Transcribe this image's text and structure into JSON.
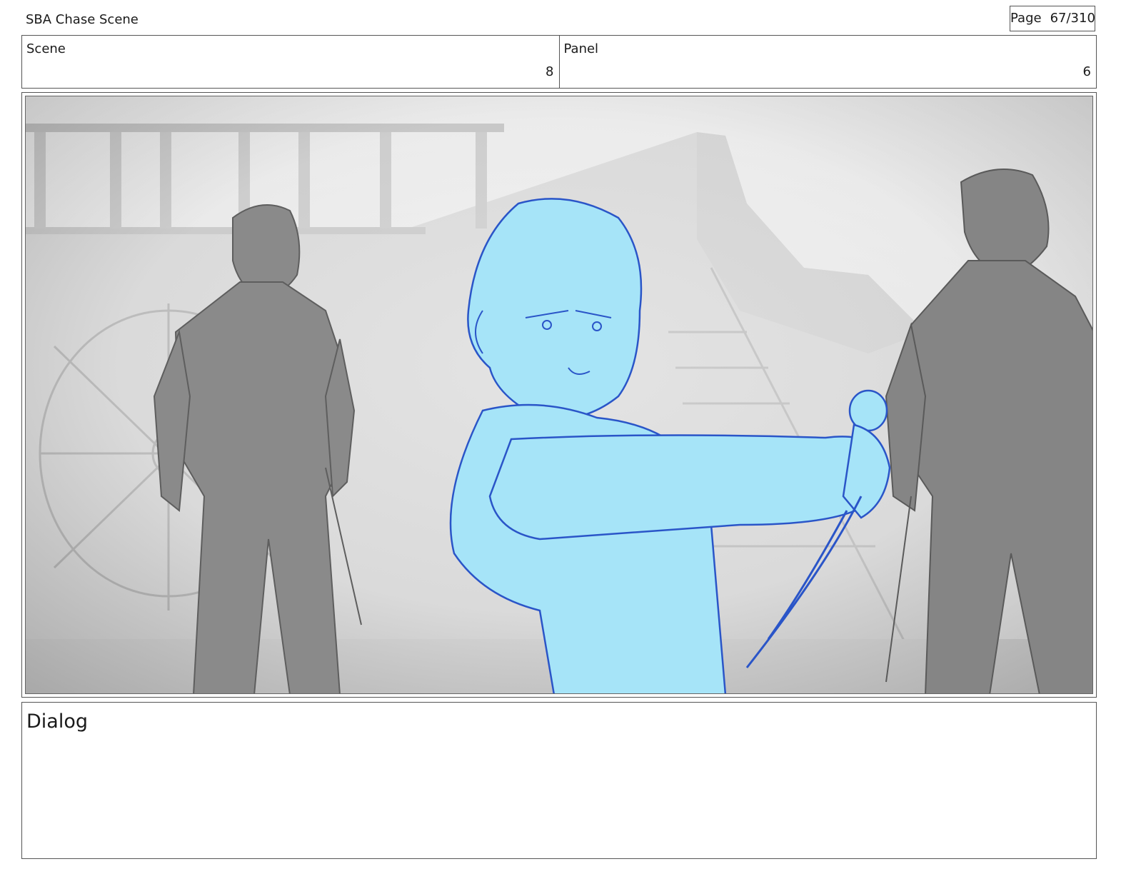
{
  "header": {
    "title": "SBA Chase Scene",
    "page_label": "Page",
    "page_value": "67/310"
  },
  "info": {
    "scene_label": "Scene",
    "scene_value": "8",
    "panel_label": "Panel",
    "panel_value": "6"
  },
  "panel_image": {
    "icon": "storyboard-sketch-image",
    "colors": {
      "background": "#dcdcdc",
      "figure_gray": "#8a8a8a",
      "hero_fill": "#a6e4f8",
      "hero_line": "#2a55c8"
    }
  },
  "dialog": {
    "label": "Dialog",
    "text": ""
  }
}
